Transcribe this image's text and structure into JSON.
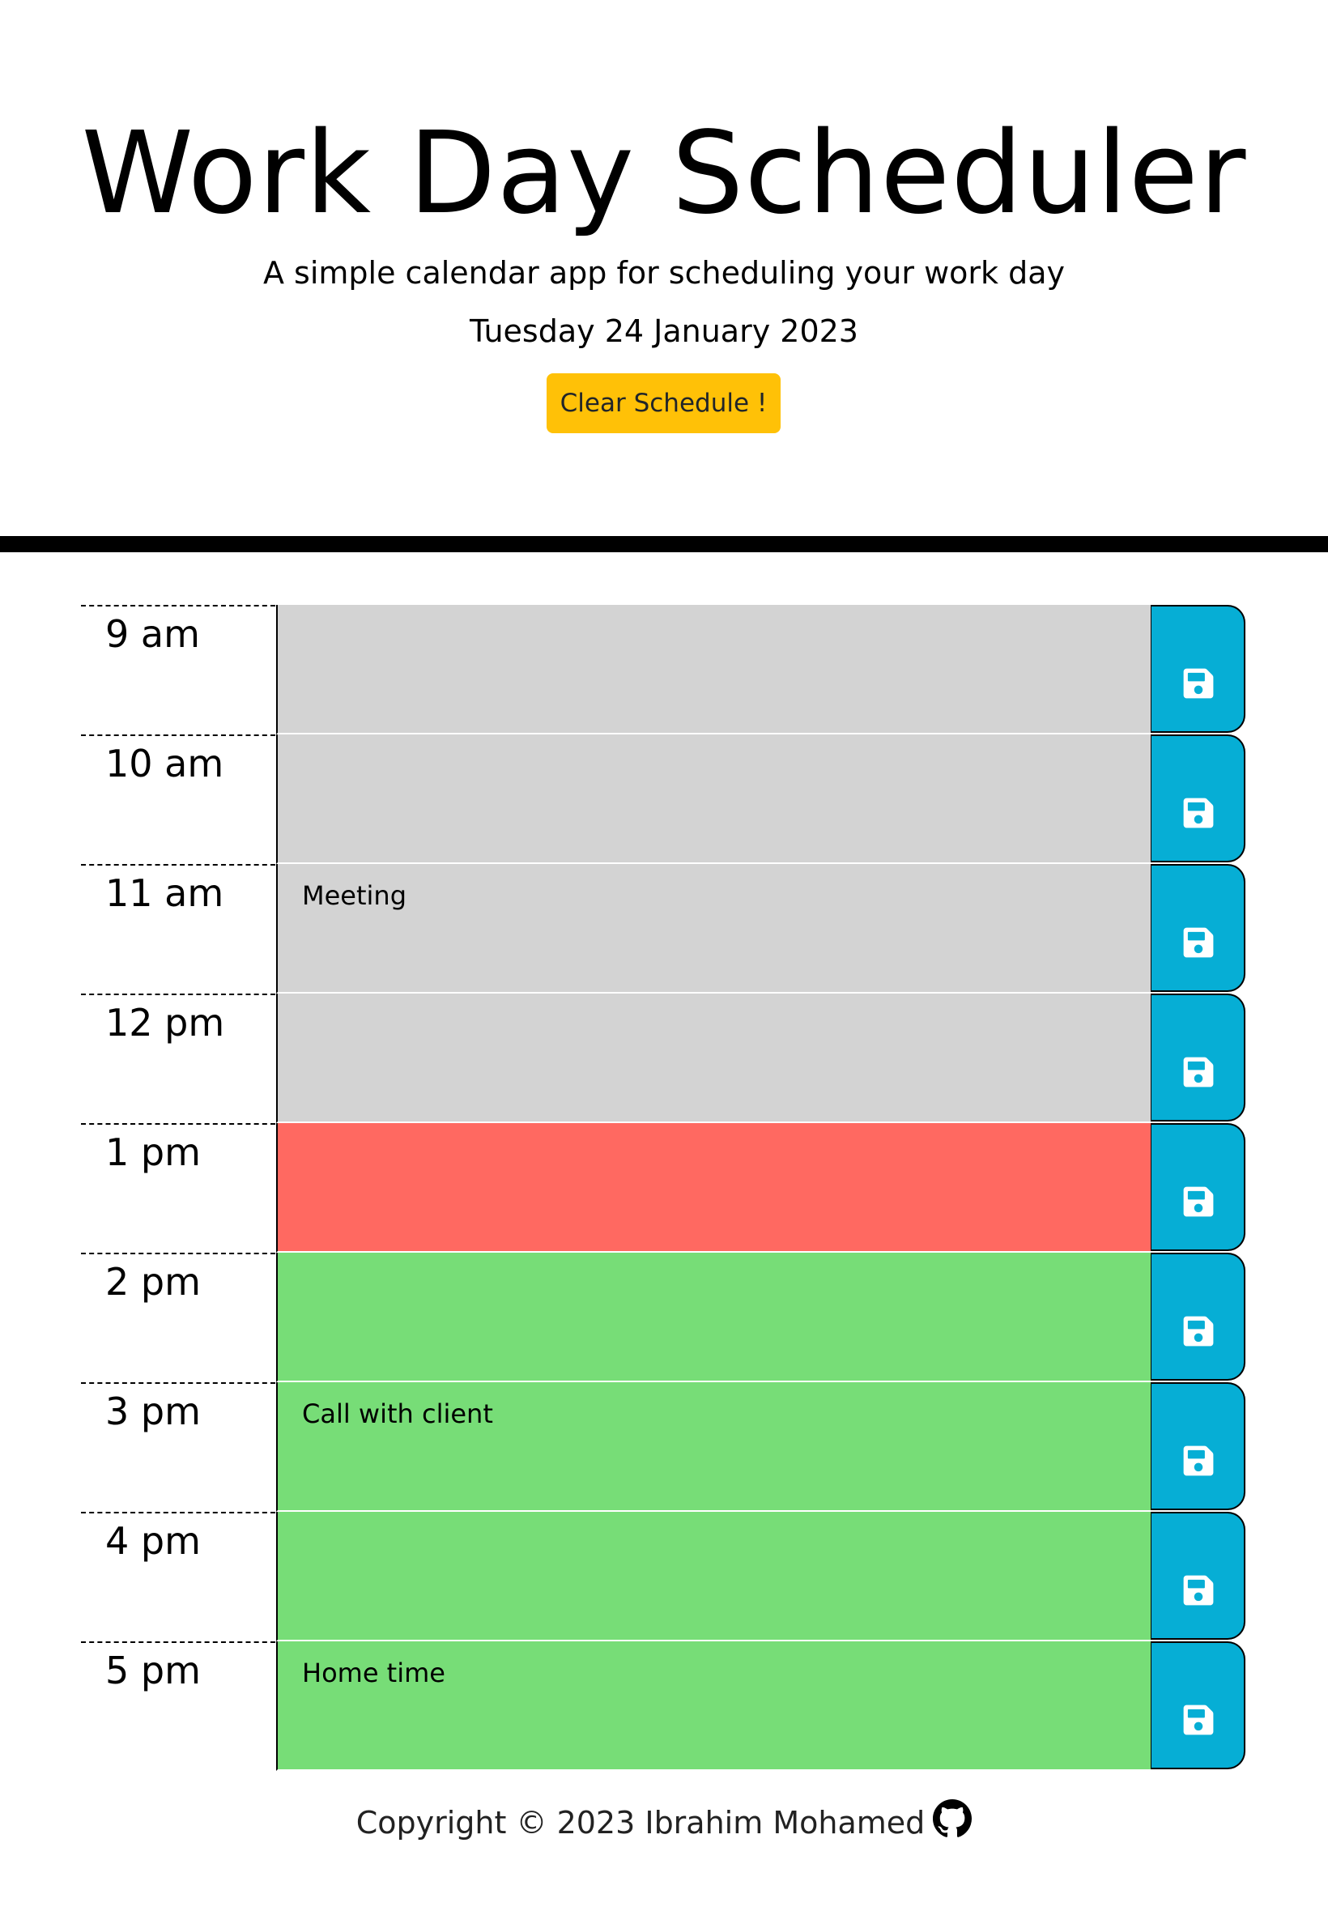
{
  "header": {
    "title": "Work Day Scheduler",
    "subtitle": "A simple calendar app for scheduling your work day",
    "date": "Tuesday 24 January 2023",
    "clear_button": "Clear Schedule !"
  },
  "colors": {
    "past": "#d3d3d3",
    "present": "#ff6961",
    "future": "#77dd77",
    "save_button": "#06aed5",
    "clear_button": "#ffc107"
  },
  "schedule": [
    {
      "hour": "9 am",
      "text": "",
      "state": "past"
    },
    {
      "hour": "10 am",
      "text": "",
      "state": "past"
    },
    {
      "hour": "11 am",
      "text": "Meeting",
      "state": "past"
    },
    {
      "hour": "12 pm",
      "text": "",
      "state": "past"
    },
    {
      "hour": "1 pm",
      "text": "",
      "state": "present"
    },
    {
      "hour": "2 pm",
      "text": "",
      "state": "future"
    },
    {
      "hour": "3 pm",
      "text": "Call with client",
      "state": "future"
    },
    {
      "hour": "4 pm",
      "text": "",
      "state": "future"
    },
    {
      "hour": "5 pm",
      "text": "Home time",
      "state": "future"
    }
  ],
  "footer": {
    "text": "Copyright © 2023 Ibrahim Mohamed",
    "icon": "github-icon"
  }
}
